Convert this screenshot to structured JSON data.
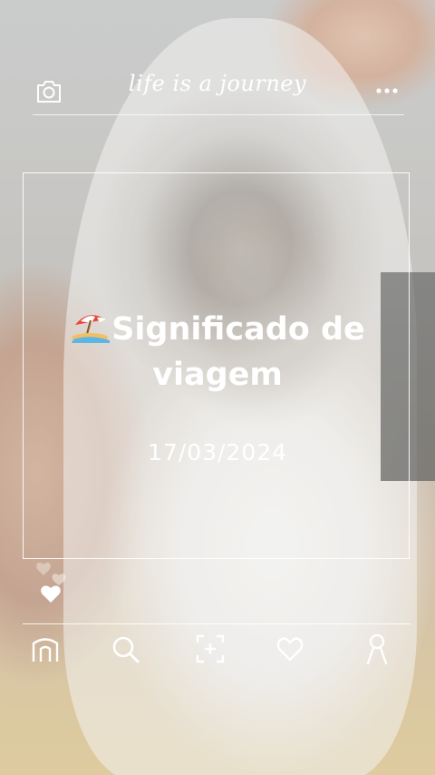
{
  "header": {
    "brand": "life is a journey",
    "camera_icon": "camera-icon",
    "more_icon": "more-dots-icon"
  },
  "post": {
    "title": "Significado de viagem",
    "emoji": "beach-umbrella-icon",
    "date": "17/03/2024"
  },
  "nav": [
    {
      "name": "home-icon"
    },
    {
      "name": "search-icon"
    },
    {
      "name": "add-icon"
    },
    {
      "name": "heart-icon"
    },
    {
      "name": "profile-icon"
    }
  ],
  "colors": {
    "overlay_text": "#ffffff",
    "lines": "#ffffff"
  }
}
